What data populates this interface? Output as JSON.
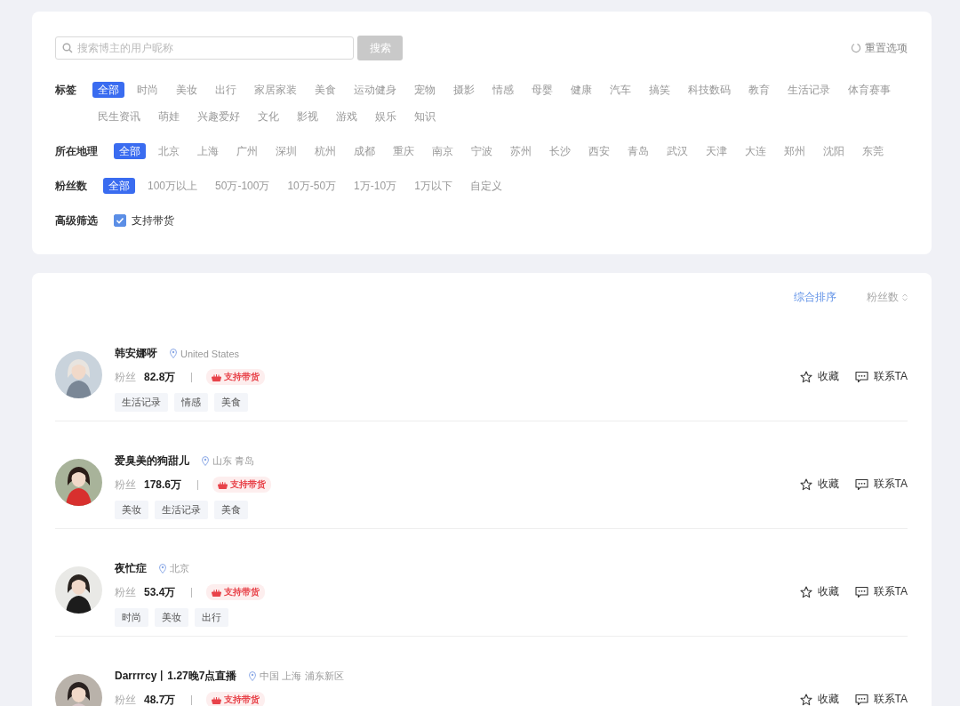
{
  "search": {
    "placeholder": "搜索博主的用户昵称",
    "button": "搜索"
  },
  "reset": "重置选项",
  "filters": [
    {
      "label": "标签",
      "options": [
        {
          "label": "全部",
          "selected": true
        },
        {
          "label": "时尚",
          "selected": false
        },
        {
          "label": "美妆",
          "selected": false
        },
        {
          "label": "出行",
          "selected": false
        },
        {
          "label": "家居家装",
          "selected": false
        },
        {
          "label": "美食",
          "selected": false
        },
        {
          "label": "运动健身",
          "selected": false
        },
        {
          "label": "宠物",
          "selected": false
        },
        {
          "label": "摄影",
          "selected": false
        },
        {
          "label": "情感",
          "selected": false
        },
        {
          "label": "母婴",
          "selected": false
        },
        {
          "label": "健康",
          "selected": false
        },
        {
          "label": "汽车",
          "selected": false
        },
        {
          "label": "搞笑",
          "selected": false
        },
        {
          "label": "科技数码",
          "selected": false
        },
        {
          "label": "教育",
          "selected": false
        },
        {
          "label": "生活记录",
          "selected": false
        },
        {
          "label": "体育赛事",
          "selected": false
        },
        {
          "label": "民生资讯",
          "selected": false
        },
        {
          "label": "萌娃",
          "selected": false
        },
        {
          "label": "兴趣爱好",
          "selected": false
        },
        {
          "label": "文化",
          "selected": false
        },
        {
          "label": "影视",
          "selected": false
        },
        {
          "label": "游戏",
          "selected": false
        },
        {
          "label": "娱乐",
          "selected": false
        },
        {
          "label": "知识",
          "selected": false
        }
      ]
    },
    {
      "label": "所在地理",
      "options": [
        {
          "label": "全部",
          "selected": true
        },
        {
          "label": "北京",
          "selected": false
        },
        {
          "label": "上海",
          "selected": false
        },
        {
          "label": "广州",
          "selected": false
        },
        {
          "label": "深圳",
          "selected": false
        },
        {
          "label": "杭州",
          "selected": false
        },
        {
          "label": "成都",
          "selected": false
        },
        {
          "label": "重庆",
          "selected": false
        },
        {
          "label": "南京",
          "selected": false
        },
        {
          "label": "宁波",
          "selected": false
        },
        {
          "label": "苏州",
          "selected": false
        },
        {
          "label": "长沙",
          "selected": false
        },
        {
          "label": "西安",
          "selected": false
        },
        {
          "label": "青岛",
          "selected": false
        },
        {
          "label": "武汉",
          "selected": false
        },
        {
          "label": "天津",
          "selected": false
        },
        {
          "label": "大连",
          "selected": false
        },
        {
          "label": "郑州",
          "selected": false
        },
        {
          "label": "沈阳",
          "selected": false
        },
        {
          "label": "东莞",
          "selected": false
        }
      ]
    },
    {
      "label": "粉丝数",
      "options": [
        {
          "label": "全部",
          "selected": true
        },
        {
          "label": "100万以上",
          "selected": false
        },
        {
          "label": "50万-100万",
          "selected": false
        },
        {
          "label": "10万-50万",
          "selected": false
        },
        {
          "label": "1万-10万",
          "selected": false
        },
        {
          "label": "1万以下",
          "selected": false
        },
        {
          "label": "自定义",
          "selected": false
        }
      ]
    }
  ],
  "advanced": {
    "label": "高级筛选",
    "option": {
      "label": "支持带货",
      "checked": true
    }
  },
  "sort": [
    {
      "label": "综合排序",
      "selected": true
    },
    {
      "label": "粉丝数",
      "selected": false
    }
  ],
  "bloggers": [
    {
      "name": "韩安娜呀",
      "location": "United States",
      "fans_label": "粉丝",
      "fans": "82.8万",
      "badge": "支持带货",
      "tags": [
        "生活记录",
        "情感",
        "美食"
      ],
      "actions": [
        "收藏",
        "联系TA"
      ]
    },
    {
      "name": "爱臭美的狗甜儿",
      "location": "山东 青岛",
      "fans_label": "粉丝",
      "fans": "178.6万",
      "badge": "支持带货",
      "tags": [
        "美妆",
        "生活记录",
        "美食"
      ],
      "actions": [
        "收藏",
        "联系TA"
      ]
    },
    {
      "name": "夜忙症",
      "location": "北京",
      "fans_label": "粉丝",
      "fans": "53.4万",
      "badge": "支持带货",
      "tags": [
        "时尚",
        "美妆",
        "出行"
      ],
      "actions": [
        "收藏",
        "联系TA"
      ]
    },
    {
      "name": "Darrrrcy丨1.27晚7点直播",
      "location": "中国 上海 浦东新区",
      "fans_label": "粉丝",
      "fans": "48.7万",
      "badge": "支持带货",
      "actions": [
        "收藏",
        "联系TA"
      ]
    }
  ]
}
